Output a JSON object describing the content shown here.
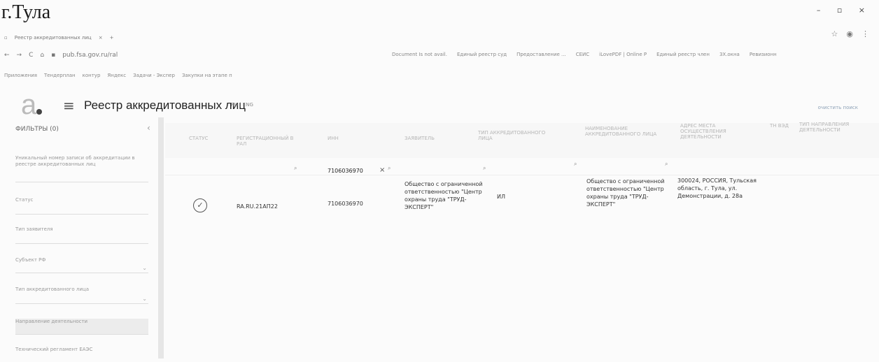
{
  "city": "г.Тула",
  "window_controls": [
    "–",
    "▫",
    "×"
  ],
  "browser": {
    "tab_label": "Реестр аккредитованных лиц",
    "url": "pub.fsa.gov.ru/ral",
    "bookmarks_left": [
      "Приложения",
      "Тендерплан",
      "контур",
      "Яндекс",
      "Задачи - Экспер",
      "Закупки на этапе п"
    ],
    "bookmarks_right": [
      "Document Is not avail.",
      "Единый реестр суд",
      "Предоставление ...",
      "СЕИС",
      "iLovePDF | Online P",
      "Единый реестр член",
      "3X.окна",
      "Ревизионн"
    ]
  },
  "header": {
    "logo": "a",
    "title": "Реестр аккредитованных лиц",
    "lang": "RU | ENG",
    "clear_filters": "очистить поиск"
  },
  "filters": {
    "title": "ФИЛЬТРЫ (0)",
    "items": [
      "Уникальный номер записи об аккредитации в реестре аккредитованных лиц",
      "Статус",
      "Тип заявителя",
      "Субъект РФ",
      "Тип аккредитованного лица",
      "Направление деятельности",
      "Технический регламент ЕАЭС"
    ]
  },
  "table": {
    "columns": [
      "СТАТУС",
      "РЕГИСТРАЦИОННЫЙ В РАЛ",
      "ИНН",
      "ЗАЯВИТЕЛЬ",
      "ТИП АККРЕДИТОВАННОГО ЛИЦА",
      "НАИМЕНОВАНИЕ АККРЕДИТОВАННОГО ЛИЦА",
      "АДРЕС МЕСТА ОСУЩЕСТВЛЕНИЯ ДЕЯТЕЛЬНОСТИ",
      "ТН ВЭД",
      "ТИП НАПРАВЛЕНИЯ ДЕЯТЕЛЬНОСТИ"
    ],
    "inn_filter_value": "7106036970",
    "row": {
      "status_icon": "check-circle",
      "reg_number": "RA.RU.21АП22",
      "inn": "7106036970",
      "applicant": "Общество с ограниченной ответственностью \"Центр охраны труда \"ТРУД-ЭКСПЕРТ\"",
      "type": "ИЛ",
      "name": "Общество с ограниченной ответственностью \"Центр охраны труда \"ТРУД-ЭКСПЕРТ\"",
      "address": "300024, РОССИЯ, Тульская область, г. Тула, ул. Демонстрации, д. 28а"
    }
  }
}
